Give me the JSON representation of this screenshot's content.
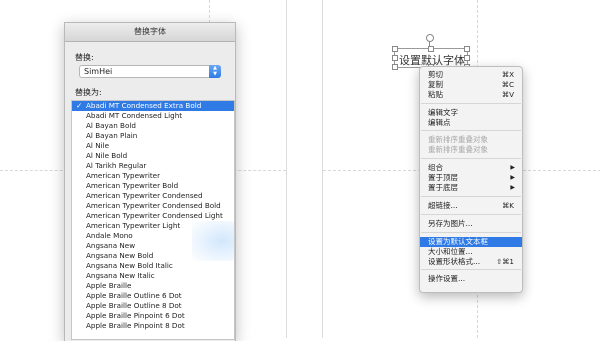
{
  "dialog": {
    "title": "替换字体",
    "replace_label": "替换:",
    "replace_value": "SimHei",
    "replace_with_label": "替换为:",
    "fonts": [
      "Abadi MT Condensed Extra Bold",
      "Abadi MT Condensed Light",
      "Al Bayan Bold",
      "Al Bayan Plain",
      "Al Nile",
      "Al Nile Bold",
      "Al Tarikh Regular",
      "American Typewriter",
      "American Typewriter Bold",
      "American Typewriter Condensed",
      "American Typewriter Condensed Bold",
      "American Typewriter Condensed Light",
      "American Typewriter Light",
      "Andale Mono",
      "Angsana New",
      "Angsana New Bold",
      "Angsana New Bold Italic",
      "Angsana New Italic",
      "Apple Braille",
      "Apple Braille Outline 6 Dot",
      "Apple Braille Outline 8 Dot",
      "Apple Braille Pinpoint 6 Dot",
      "Apple Braille Pinpoint 8 Dot"
    ],
    "selected_font": "Abadi MT Condensed Extra Bold",
    "check_glyph": "✓",
    "select_arrows": "▲▼"
  },
  "textbox": {
    "text": "设置默认字体"
  },
  "context_menu": {
    "items": [
      {
        "label": "剪切",
        "shortcut": "⌘X",
        "disabled": false
      },
      {
        "label": "复制",
        "shortcut": "⌘C",
        "disabled": false
      },
      {
        "label": "粘贴",
        "shortcut": "⌘V",
        "disabled": false
      },
      {
        "label": "编辑文字",
        "shortcut": "",
        "disabled": false
      },
      {
        "label": "编辑点",
        "shortcut": "",
        "disabled": false
      },
      {
        "label": "重新排序重叠对象",
        "shortcut": "",
        "disabled": true
      },
      {
        "label": "重新排序重叠对象",
        "shortcut": "",
        "disabled": true
      },
      {
        "label": "组合",
        "shortcut": "",
        "submenu": true,
        "disabled": false
      },
      {
        "label": "置于顶层",
        "shortcut": "",
        "submenu": true,
        "disabled": false
      },
      {
        "label": "置于底层",
        "shortcut": "",
        "submenu": true,
        "disabled": false
      },
      {
        "label": "超链接...",
        "shortcut": "⌘K",
        "disabled": false
      },
      {
        "label": "另存为图片...",
        "shortcut": "",
        "disabled": false
      },
      {
        "label": "设置为默认文本框",
        "shortcut": "",
        "disabled": false,
        "highlighted": true
      },
      {
        "label": "大小和位置...",
        "shortcut": "",
        "disabled": false
      },
      {
        "label": "设置形状格式...",
        "shortcut": "⇧⌘1",
        "disabled": false
      },
      {
        "label": "操作设置...",
        "shortcut": "",
        "disabled": false
      }
    ],
    "submenu_glyph": "▶"
  },
  "colors": {
    "accent": "#2f7ae5",
    "menu_bg": "#f3f3f3",
    "dialog_bg": "#ececec"
  }
}
